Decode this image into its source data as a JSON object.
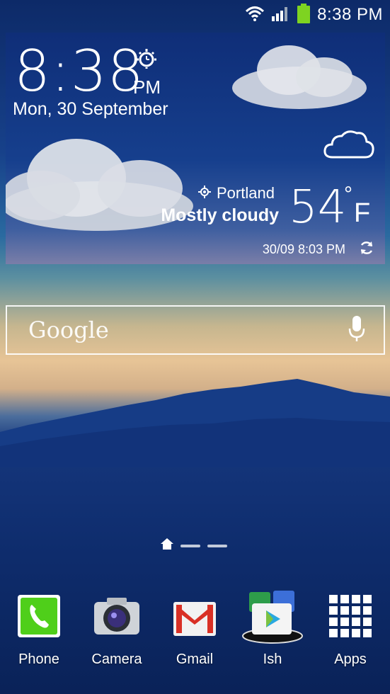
{
  "status_bar": {
    "time": "8:38 PM"
  },
  "weather_widget": {
    "clock": "8:38",
    "ampm": "PM",
    "date": "Mon, 30 September",
    "city": "Portland",
    "condition": "Mostly cloudy",
    "temperature": "54",
    "unit": "F",
    "updated": "30/09 8:03 PM"
  },
  "search": {
    "logo": "Google"
  },
  "page_indicator": {
    "current_page": 1,
    "pages": 3
  },
  "dock": {
    "apps": [
      {
        "label": "Phone",
        "icon": "phone-icon"
      },
      {
        "label": "Camera",
        "icon": "camera-icon"
      },
      {
        "label": "Gmail",
        "icon": "gmail-icon"
      },
      {
        "label": "Ish",
        "icon": "folder-icon"
      },
      {
        "label": "Apps",
        "icon": "apps-grid-icon"
      }
    ]
  }
}
